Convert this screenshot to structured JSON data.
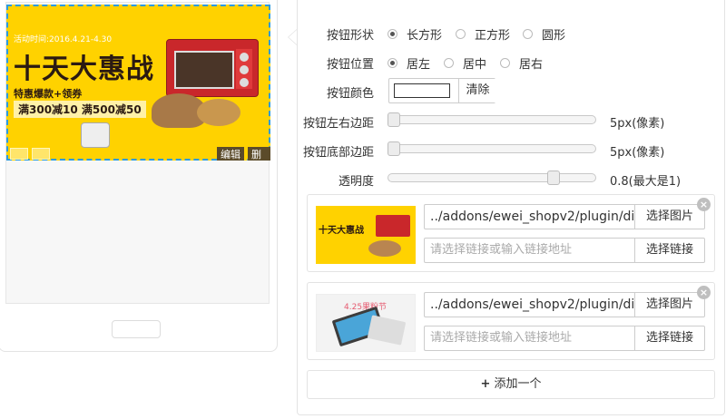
{
  "preview": {
    "banner": {
      "date_text": "活动时间:2016.4.21-4.30",
      "title": "十天大惠战",
      "subtitle": "特惠爆款+领券",
      "promo": "满300减10 满500减50",
      "edit_label": "编辑",
      "delete_label": "删除"
    }
  },
  "settings": {
    "shape": {
      "label": "按钮形状",
      "options": [
        "长方形",
        "正方形",
        "圆形"
      ],
      "selected": "长方形"
    },
    "position": {
      "label": "按钮位置",
      "options": [
        "居左",
        "居中",
        "居右"
      ],
      "selected": "居左"
    },
    "color": {
      "label": "按钮颜色",
      "value": "#ffffff",
      "clear_label": "清除"
    },
    "left_margin": {
      "label": "按钮左右边距",
      "value_text": "5px(像素)",
      "fraction": 0.0
    },
    "bottom_margin": {
      "label": "按钮底部边距",
      "value_text": "5px(像素)",
      "fraction": 0.0
    },
    "opacity": {
      "label": "透明度",
      "value_text": "0.8(最大是1)",
      "fraction": 0.8
    }
  },
  "items": [
    {
      "image_path": "../addons/ewei_shopv2/plugin/diy/",
      "pick_image_label": "选择图片",
      "link_placeholder": "请选择链接或输入链接地址",
      "pick_link_label": "选择链接",
      "thumb_title": "十天大惠战"
    },
    {
      "image_path": "../addons/ewei_shopv2/plugin/diy/",
      "pick_image_label": "选择图片",
      "link_placeholder": "请选择链接或输入链接地址",
      "pick_link_label": "选择链接",
      "thumb_title": "4.25果粉节"
    }
  ],
  "add_label": "添加一个",
  "colors": {
    "banner_bg": "#ffd200",
    "selection_outline": "#2d9bde"
  }
}
